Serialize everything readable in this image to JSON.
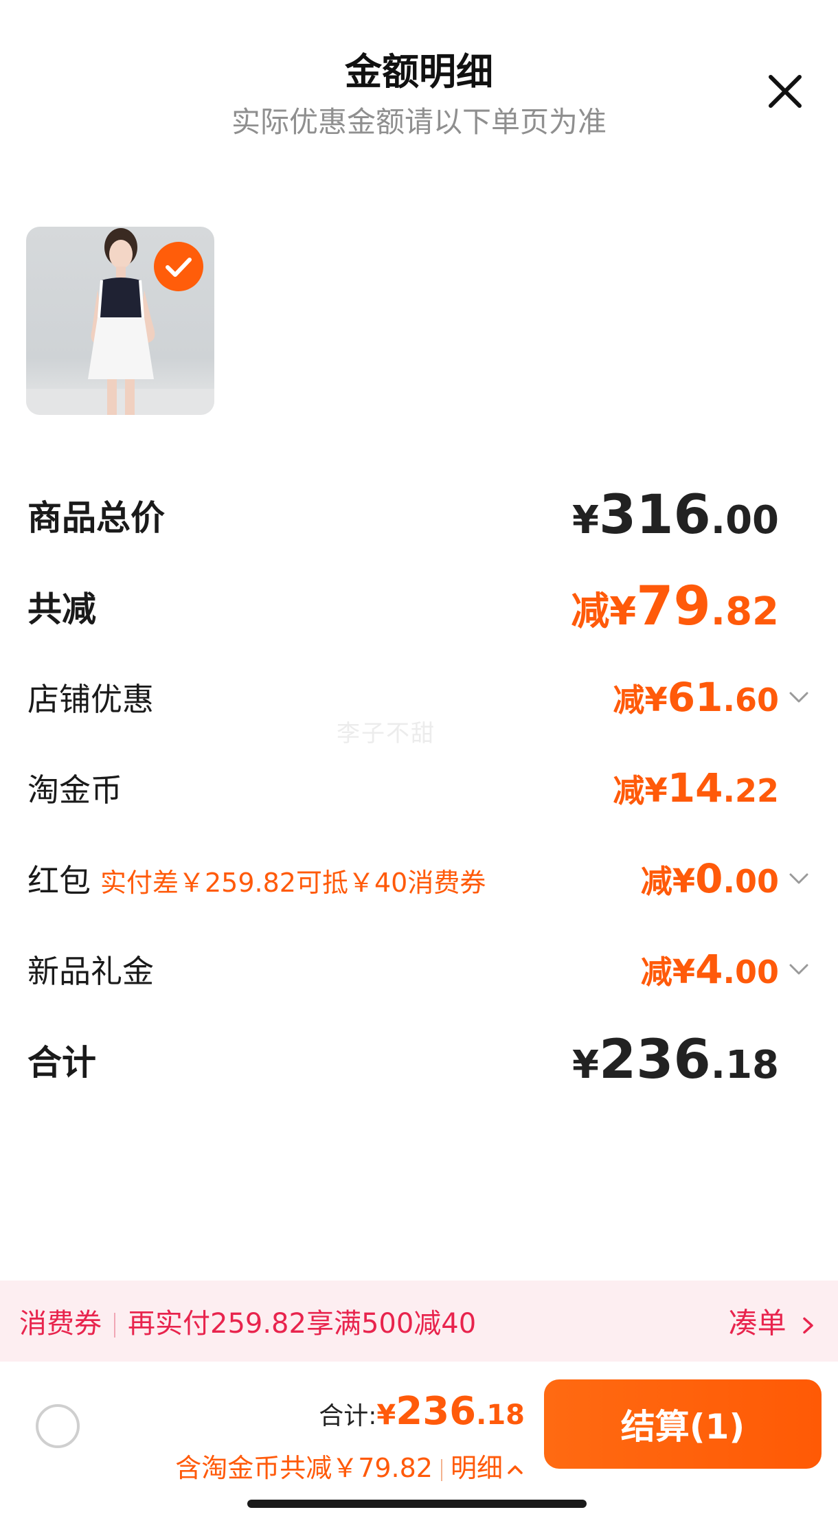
{
  "header": {
    "title": "金额明细",
    "subtitle": "实际优惠金额请以下单页为准"
  },
  "watermark": "李子不甜",
  "rows": [
    {
      "label": "商品总价",
      "prefix": "",
      "yen": "¥",
      "int": "316",
      "dec": ".00",
      "color": "#222222",
      "expandable": false
    },
    {
      "label": "共减",
      "prefix": "减",
      "yen": "¥",
      "int": "79",
      "dec": ".82",
      "color": "#ff5a0a",
      "expandable": false
    },
    {
      "label": "店铺优惠",
      "prefix": "减",
      "yen": "¥",
      "int": "61",
      "dec": ".60",
      "color": "#ff5a0a",
      "expandable": true
    },
    {
      "label": "淘金币",
      "prefix": "减",
      "yen": "¥",
      "int": "14",
      "dec": ".22",
      "color": "#ff5a0a",
      "expandable": false
    },
    {
      "label": "红包",
      "note": "实付差￥259.82可抵￥40消费券",
      "prefix": "减",
      "yen": "¥",
      "int": "0",
      "dec": ".00",
      "color": "#ff5a0a",
      "expandable": true
    },
    {
      "label": "新品礼金",
      "prefix": "减",
      "yen": "¥",
      "int": "4",
      "dec": ".00",
      "color": "#ff5a0a",
      "expandable": true
    },
    {
      "label": "合计",
      "prefix": "",
      "yen": "¥",
      "int": "236",
      "dec": ".18",
      "color": "#222222",
      "expandable": false
    }
  ],
  "promo": {
    "coupon_label": "消费券",
    "message": "再实付259.82享满500减40",
    "cta": "凑单",
    "cta_icon": "chevron-right-icon"
  },
  "footer": {
    "total_label": "合计:",
    "total_yen": "¥",
    "total_int": "236",
    "total_dec": ".18",
    "saving_text": "含淘金币共减￥79.82",
    "detail_label": "明细",
    "detail_icon": "chevron-up-icon",
    "checkout_label": "结算(1)"
  },
  "colors": {
    "accent": "#ff5a0a",
    "promo_bg": "#fdeef1",
    "promo_text": "#e8244d"
  }
}
